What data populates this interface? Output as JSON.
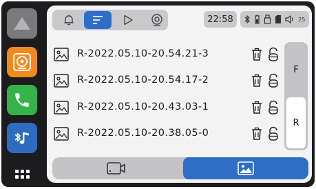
{
  "dock": {
    "items": [
      {
        "name": "home",
        "icon": "home-triangle-icon"
      },
      {
        "name": "dashcam",
        "icon": "dashcam-lens-icon",
        "color": "#f08a1d"
      },
      {
        "name": "phone",
        "icon": "phone-icon",
        "color": "#36b24a"
      },
      {
        "name": "bluetooth-music",
        "icon": "bluetooth-music-icon",
        "color": "#2d6cc0"
      },
      {
        "name": "apps",
        "icon": "apps-grid-icon"
      }
    ]
  },
  "tabs": [
    {
      "name": "notifications",
      "icon": "bell-icon"
    },
    {
      "name": "file-list",
      "icon": "list-icon",
      "active": true
    },
    {
      "name": "playback",
      "icon": "play-icon"
    },
    {
      "name": "record",
      "icon": "record-icon"
    }
  ],
  "status": {
    "time": "22:58",
    "volume": "25",
    "icons": [
      "bluetooth-icon",
      "battery-icon",
      "usb-icon",
      "sd-card-icon",
      "volume-icon"
    ]
  },
  "files": [
    {
      "name": "R-2022.05.10-20.54.21-3"
    },
    {
      "name": "R-2022.05.10-20.54.17-2"
    },
    {
      "name": "R-2022.05.10-20.43.03-1"
    },
    {
      "name": "R-2022.05.10-20.38.05-0"
    }
  ],
  "camera_switch": {
    "front_label": "F",
    "rear_label": "R",
    "selected": "R"
  },
  "media_type": {
    "options": [
      "video",
      "photo"
    ],
    "selected": "photo"
  },
  "colors": {
    "accent": "#2f6ec7",
    "panel": "#f3f3f4",
    "frame": "#1c1c1e"
  }
}
